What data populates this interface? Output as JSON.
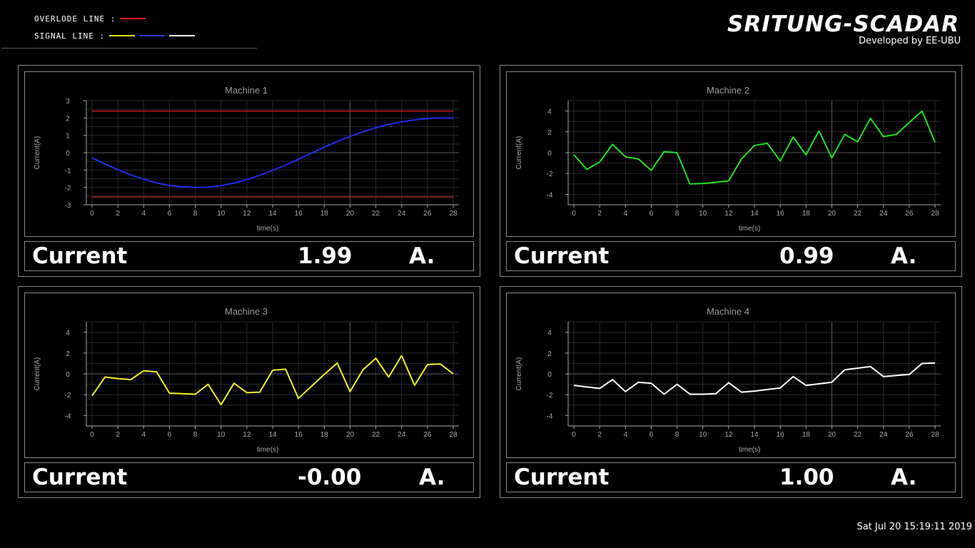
{
  "legend": {
    "overload_label": "OVERLODE LINE :",
    "signal_label": "SIGNAL LINE :",
    "overload_color": "#e02020",
    "signal_colors": [
      "#d4e21a",
      "#2b3fe0",
      "#ffffff"
    ]
  },
  "brand": {
    "title": "SRITUNG-SCADAR",
    "subtitle": "Developed by EE-UBU"
  },
  "timestamp": "Sat Jul 20 15:19:11 2019",
  "machines": [
    {
      "readout": {
        "label": "Current",
        "value": "1.99",
        "unit": "A."
      }
    },
    {
      "readout": {
        "label": "Current",
        "value": "0.99",
        "unit": "A."
      }
    },
    {
      "readout": {
        "label": "Current",
        "value": "-0.00",
        "unit": "A."
      }
    },
    {
      "readout": {
        "label": "Current",
        "value": "1.00",
        "unit": "A."
      }
    }
  ],
  "chart_data": [
    {
      "type": "line",
      "title": "Machine 1",
      "xlabel": "time(s)",
      "ylabel": "Current(A)",
      "xlim": [
        0,
        28
      ],
      "ylim": [
        -3,
        3
      ],
      "xticks": [
        0,
        2,
        4,
        6,
        8,
        10,
        12,
        14,
        16,
        18,
        20,
        22,
        24,
        26,
        28
      ],
      "yticks": [
        3,
        2,
        1,
        0,
        -1,
        -2,
        -3
      ],
      "grid": true,
      "color": "#1c2ee8",
      "overload": [
        2.4,
        -2.55
      ],
      "x": [
        0,
        1,
        2,
        3,
        4,
        5,
        6,
        7,
        8,
        9,
        10,
        11,
        12,
        13,
        14,
        15,
        16,
        17,
        18,
        19,
        20,
        21,
        22,
        23,
        24,
        25,
        26,
        27,
        28
      ],
      "y": [
        -0.3,
        -0.65,
        -0.98,
        -1.28,
        -1.53,
        -1.74,
        -1.89,
        -1.97,
        -2.0,
        -1.98,
        -1.9,
        -1.75,
        -1.55,
        -1.3,
        -1.02,
        -0.72,
        -0.38,
        -0.03,
        0.32,
        0.64,
        0.94,
        1.2,
        1.44,
        1.63,
        1.78,
        1.89,
        1.96,
        2.0,
        1.99
      ]
    },
    {
      "type": "line",
      "title": "Machine 2",
      "xlabel": "time(s)",
      "ylabel": "Current(A)",
      "xlim": [
        0,
        28
      ],
      "ylim": [
        -5,
        5
      ],
      "xticks": [
        0,
        2,
        4,
        6,
        8,
        10,
        12,
        14,
        16,
        18,
        20,
        22,
        24,
        26,
        28
      ],
      "yticks": [
        4,
        2,
        0,
        -2,
        -4
      ],
      "grid": true,
      "color": "#22e022",
      "x": [
        0,
        1,
        2,
        3,
        4,
        5,
        6,
        7,
        8,
        9,
        10,
        11,
        12,
        13,
        14,
        15,
        16,
        17,
        18,
        19,
        20,
        21,
        22,
        23,
        24,
        25,
        26,
        27,
        28
      ],
      "y": [
        -0.2,
        -1.6,
        -0.9,
        0.8,
        -0.4,
        -0.6,
        -1.7,
        0.1,
        0.0,
        -3.0,
        -2.95,
        -2.85,
        -2.7,
        -0.6,
        0.7,
        0.9,
        -0.8,
        1.5,
        -0.2,
        2.1,
        -0.5,
        1.75,
        1.05,
        3.3,
        1.55,
        1.75,
        2.9,
        4.0,
        0.99
      ]
    },
    {
      "type": "line",
      "title": "Machine 3",
      "xlabel": "time(s)",
      "ylabel": "Current(A)",
      "xlim": [
        0,
        28
      ],
      "ylim": [
        -5,
        5
      ],
      "xticks": [
        0,
        2,
        4,
        6,
        8,
        10,
        12,
        14,
        16,
        18,
        20,
        22,
        24,
        26,
        28
      ],
      "yticks": [
        4,
        2,
        0,
        -2,
        -4
      ],
      "grid": true,
      "color": "#f0f020",
      "x": [
        0,
        1,
        2,
        3,
        4,
        5,
        6,
        7,
        8,
        9,
        10,
        11,
        12,
        13,
        14,
        15,
        16,
        17,
        18,
        19,
        20,
        21,
        22,
        23,
        24,
        25,
        26,
        27,
        28
      ],
      "y": [
        -2.1,
        -0.3,
        -0.45,
        -0.55,
        0.3,
        0.2,
        -1.85,
        -1.9,
        -1.95,
        -1.0,
        -2.95,
        -0.9,
        -1.8,
        -1.75,
        0.35,
        0.45,
        -2.35,
        -1.2,
        -0.05,
        1.05,
        -1.7,
        0.4,
        1.5,
        -0.3,
        1.75,
        -1.1,
        0.9,
        0.95,
        0.0
      ]
    },
    {
      "type": "line",
      "title": "Machine 4",
      "xlabel": "time(s)",
      "ylabel": "Current(A)",
      "xlim": [
        0,
        28
      ],
      "ylim": [
        -5,
        5
      ],
      "xticks": [
        0,
        2,
        4,
        6,
        8,
        10,
        12,
        14,
        16,
        18,
        20,
        22,
        24,
        26,
        28
      ],
      "yticks": [
        4,
        2,
        0,
        -2,
        -4
      ],
      "grid": true,
      "color": "#ffffff",
      "x": [
        0,
        1,
        2,
        3,
        4,
        5,
        6,
        7,
        8,
        9,
        10,
        11,
        12,
        13,
        14,
        15,
        16,
        17,
        18,
        19,
        20,
        21,
        22,
        23,
        24,
        25,
        26,
        27,
        28
      ],
      "y": [
        -1.1,
        -1.25,
        -1.4,
        -0.55,
        -1.7,
        -0.8,
        -0.9,
        -1.95,
        -1.0,
        -1.95,
        -1.95,
        -1.9,
        -0.85,
        -1.75,
        -1.65,
        -1.5,
        -1.35,
        -0.25,
        -1.1,
        -0.95,
        -0.8,
        0.4,
        0.55,
        0.7,
        -0.25,
        -0.15,
        -0.05,
        1.0,
        1.05
      ]
    }
  ]
}
